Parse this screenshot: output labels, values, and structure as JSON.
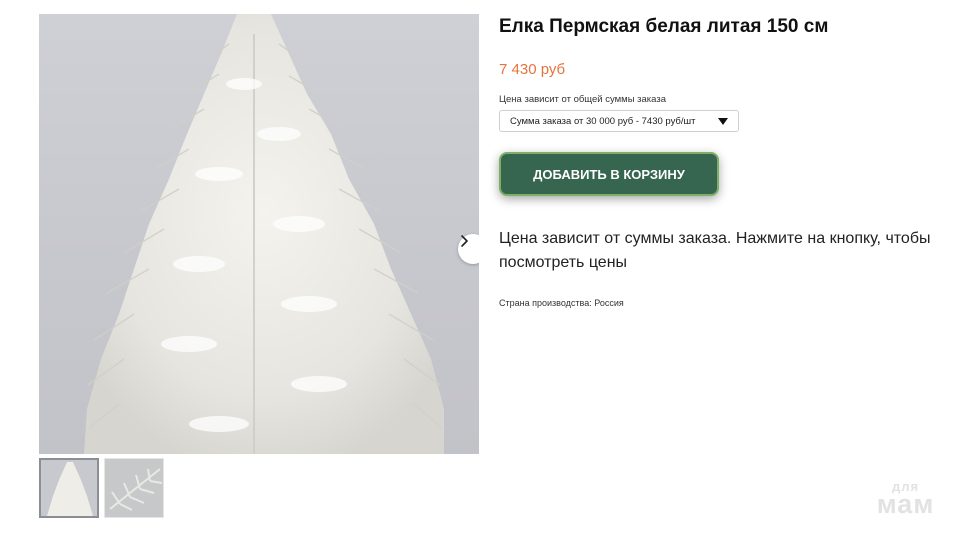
{
  "gallery": {
    "main_image_alt": "",
    "next_icon": "chevron-right-icon",
    "thumbnails": [
      {
        "selected": true
      },
      {
        "selected": false
      }
    ]
  },
  "product": {
    "title": "Елка Пермская белая литая 150 см",
    "price": "7 430 руб",
    "price_color": "#e5743e",
    "option_label": "Цена зависит от общей суммы заказа",
    "option_selected": "Сумма заказа от 30 000 руб - 7430 руб/шт",
    "add_to_cart_label": "ДОБАВИТЬ В КОРЗИНУ",
    "button_color": "#36664f",
    "description": "Цена зависит от суммы заказа. Нажмите на кнопку, чтобы посмотреть цены",
    "origin_label": "Страна производства:",
    "origin_value": "Россия"
  },
  "watermark": {
    "top": "для",
    "bottom": "мам"
  }
}
